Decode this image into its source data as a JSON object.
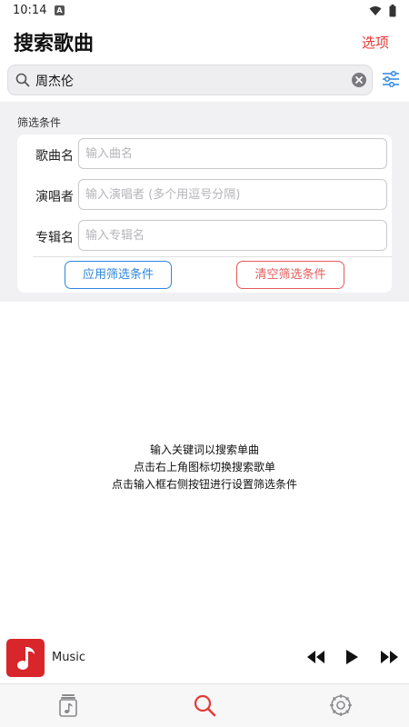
{
  "status_bar": {
    "time": "10:14",
    "notification_letter": "A"
  },
  "header": {
    "title": "搜索歌曲",
    "options_label": "选项"
  },
  "search": {
    "value": "周杰伦"
  },
  "filter": {
    "section_title": "筛选条件",
    "fields": [
      {
        "label": "歌曲名",
        "placeholder": "输入曲名"
      },
      {
        "label": "演唱者",
        "placeholder": "输入演唱者 (多个用逗号分隔)"
      },
      {
        "label": "专辑名",
        "placeholder": "输入专辑名"
      }
    ],
    "apply_label": "应用筛选条件",
    "clear_label": "清空筛选条件"
  },
  "hint": {
    "line1": "输入关键词以搜索单曲",
    "line2": "点击右上角图标切换搜索歌单",
    "line3": "点击输入框右侧按钮进行设置筛选条件"
  },
  "player": {
    "track_title": "Music"
  },
  "tabs": [
    {
      "name": "library",
      "icon": "music-library-icon",
      "active": false
    },
    {
      "name": "search",
      "icon": "search-icon",
      "active": true
    },
    {
      "name": "settings",
      "icon": "settings-gear-icon",
      "active": false
    }
  ],
  "colors": {
    "accent_red": "#e53935",
    "accent_blue": "#2d86e0",
    "album_red": "#d8262b"
  }
}
